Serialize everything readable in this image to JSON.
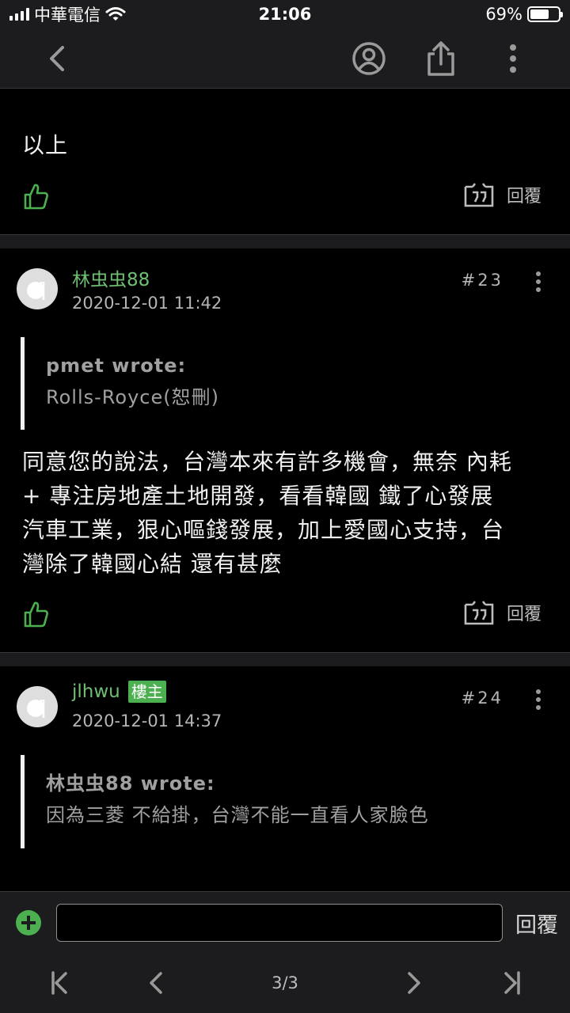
{
  "status_bar": {
    "carrier": "中華電信",
    "time": "21:06",
    "battery_text": "69%",
    "battery_level": 0.69
  },
  "nav": {
    "icons": [
      "chevron-left-icon",
      "profile-icon",
      "share-icon",
      "more-vertical-icon"
    ]
  },
  "previous_post": {
    "text": "以上",
    "reply_label": "回覆"
  },
  "posts": [
    {
      "author": "林虫虫88",
      "op_badge": "",
      "timestamp": "2020-12-01 11:42",
      "floor": "#23",
      "quote_author": "pmet wrote:",
      "quote_text": "Rolls-Royce(恕刪)",
      "body_lines": [
        "同意您的說法，台灣本來有許多機會，無奈 內耗",
        "+ 專注房地產土地開發，看看韓國 鐵了心發展",
        "汽車工業，狠心嘔錢發展，加上愛國心支持，台",
        "灣除了韓國心結 還有甚麼"
      ],
      "reply_label": "回覆"
    },
    {
      "author": "jlhwu",
      "op_badge": "樓主",
      "timestamp": "2020-12-01 14:37",
      "floor": "#24",
      "quote_author": "林虫虫88 wrote:",
      "quote_text": "因為三菱 不給掛，台灣不能一直看人家臉色"
    }
  ],
  "reply_bar": {
    "input_value": "",
    "send_label": "回覆"
  },
  "pager": {
    "page_label": "3/3"
  },
  "colors": {
    "accent_green": "#4caf50",
    "author_green": "#6fbf73",
    "bar_bg": "#1c1c1e"
  }
}
